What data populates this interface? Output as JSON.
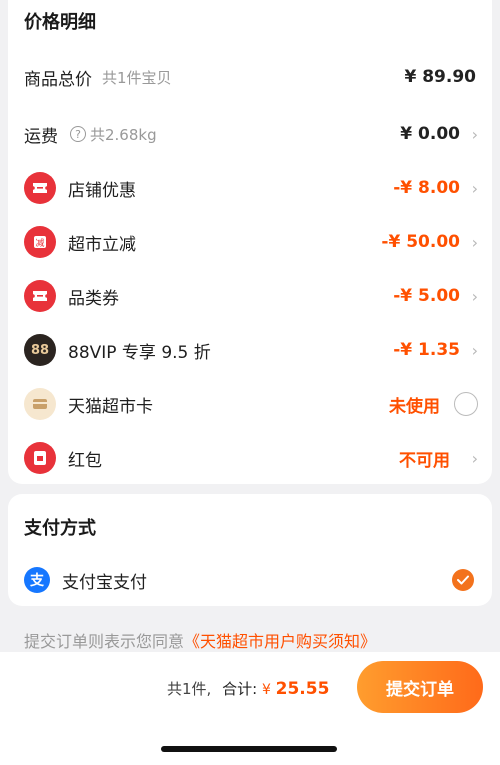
{
  "price_detail": {
    "title": "价格明细",
    "rows": [
      {
        "label": "商品总价",
        "sub": "共1件宝贝",
        "value": "¥ 89.90"
      },
      {
        "label": "运费",
        "sub": "共2.68kg",
        "value": "¥ 0.00"
      },
      {
        "label": "店铺优惠",
        "value": "-¥ 8.00"
      },
      {
        "label": "超市立减",
        "value": "-¥ 50.00"
      },
      {
        "label": "品类券",
        "value": "-¥ 5.00"
      },
      {
        "label": "88VIP 专享 9.5 折",
        "value": "-¥ 1.35",
        "icon_text": "88"
      },
      {
        "label": "天猫超市卡",
        "value": "未使用"
      },
      {
        "label": "红包",
        "value": "不可用"
      }
    ]
  },
  "payment": {
    "title": "支付方式",
    "method": "支付宝支付",
    "alipay_icon_text": "支"
  },
  "agreement": {
    "prefix": "提交订单则表示您同意",
    "link": "《天猫超市用户购买须知》"
  },
  "footer": {
    "count_text": "共1件,",
    "total_label": "合计:",
    "currency": "¥",
    "total_amount": "25.55",
    "submit_label": "提交订单"
  },
  "colors": {
    "accent": "#ff5000",
    "coupon_red": "#e8323a",
    "alipay_blue": "#1677ff",
    "check_orange": "#f3721c"
  }
}
